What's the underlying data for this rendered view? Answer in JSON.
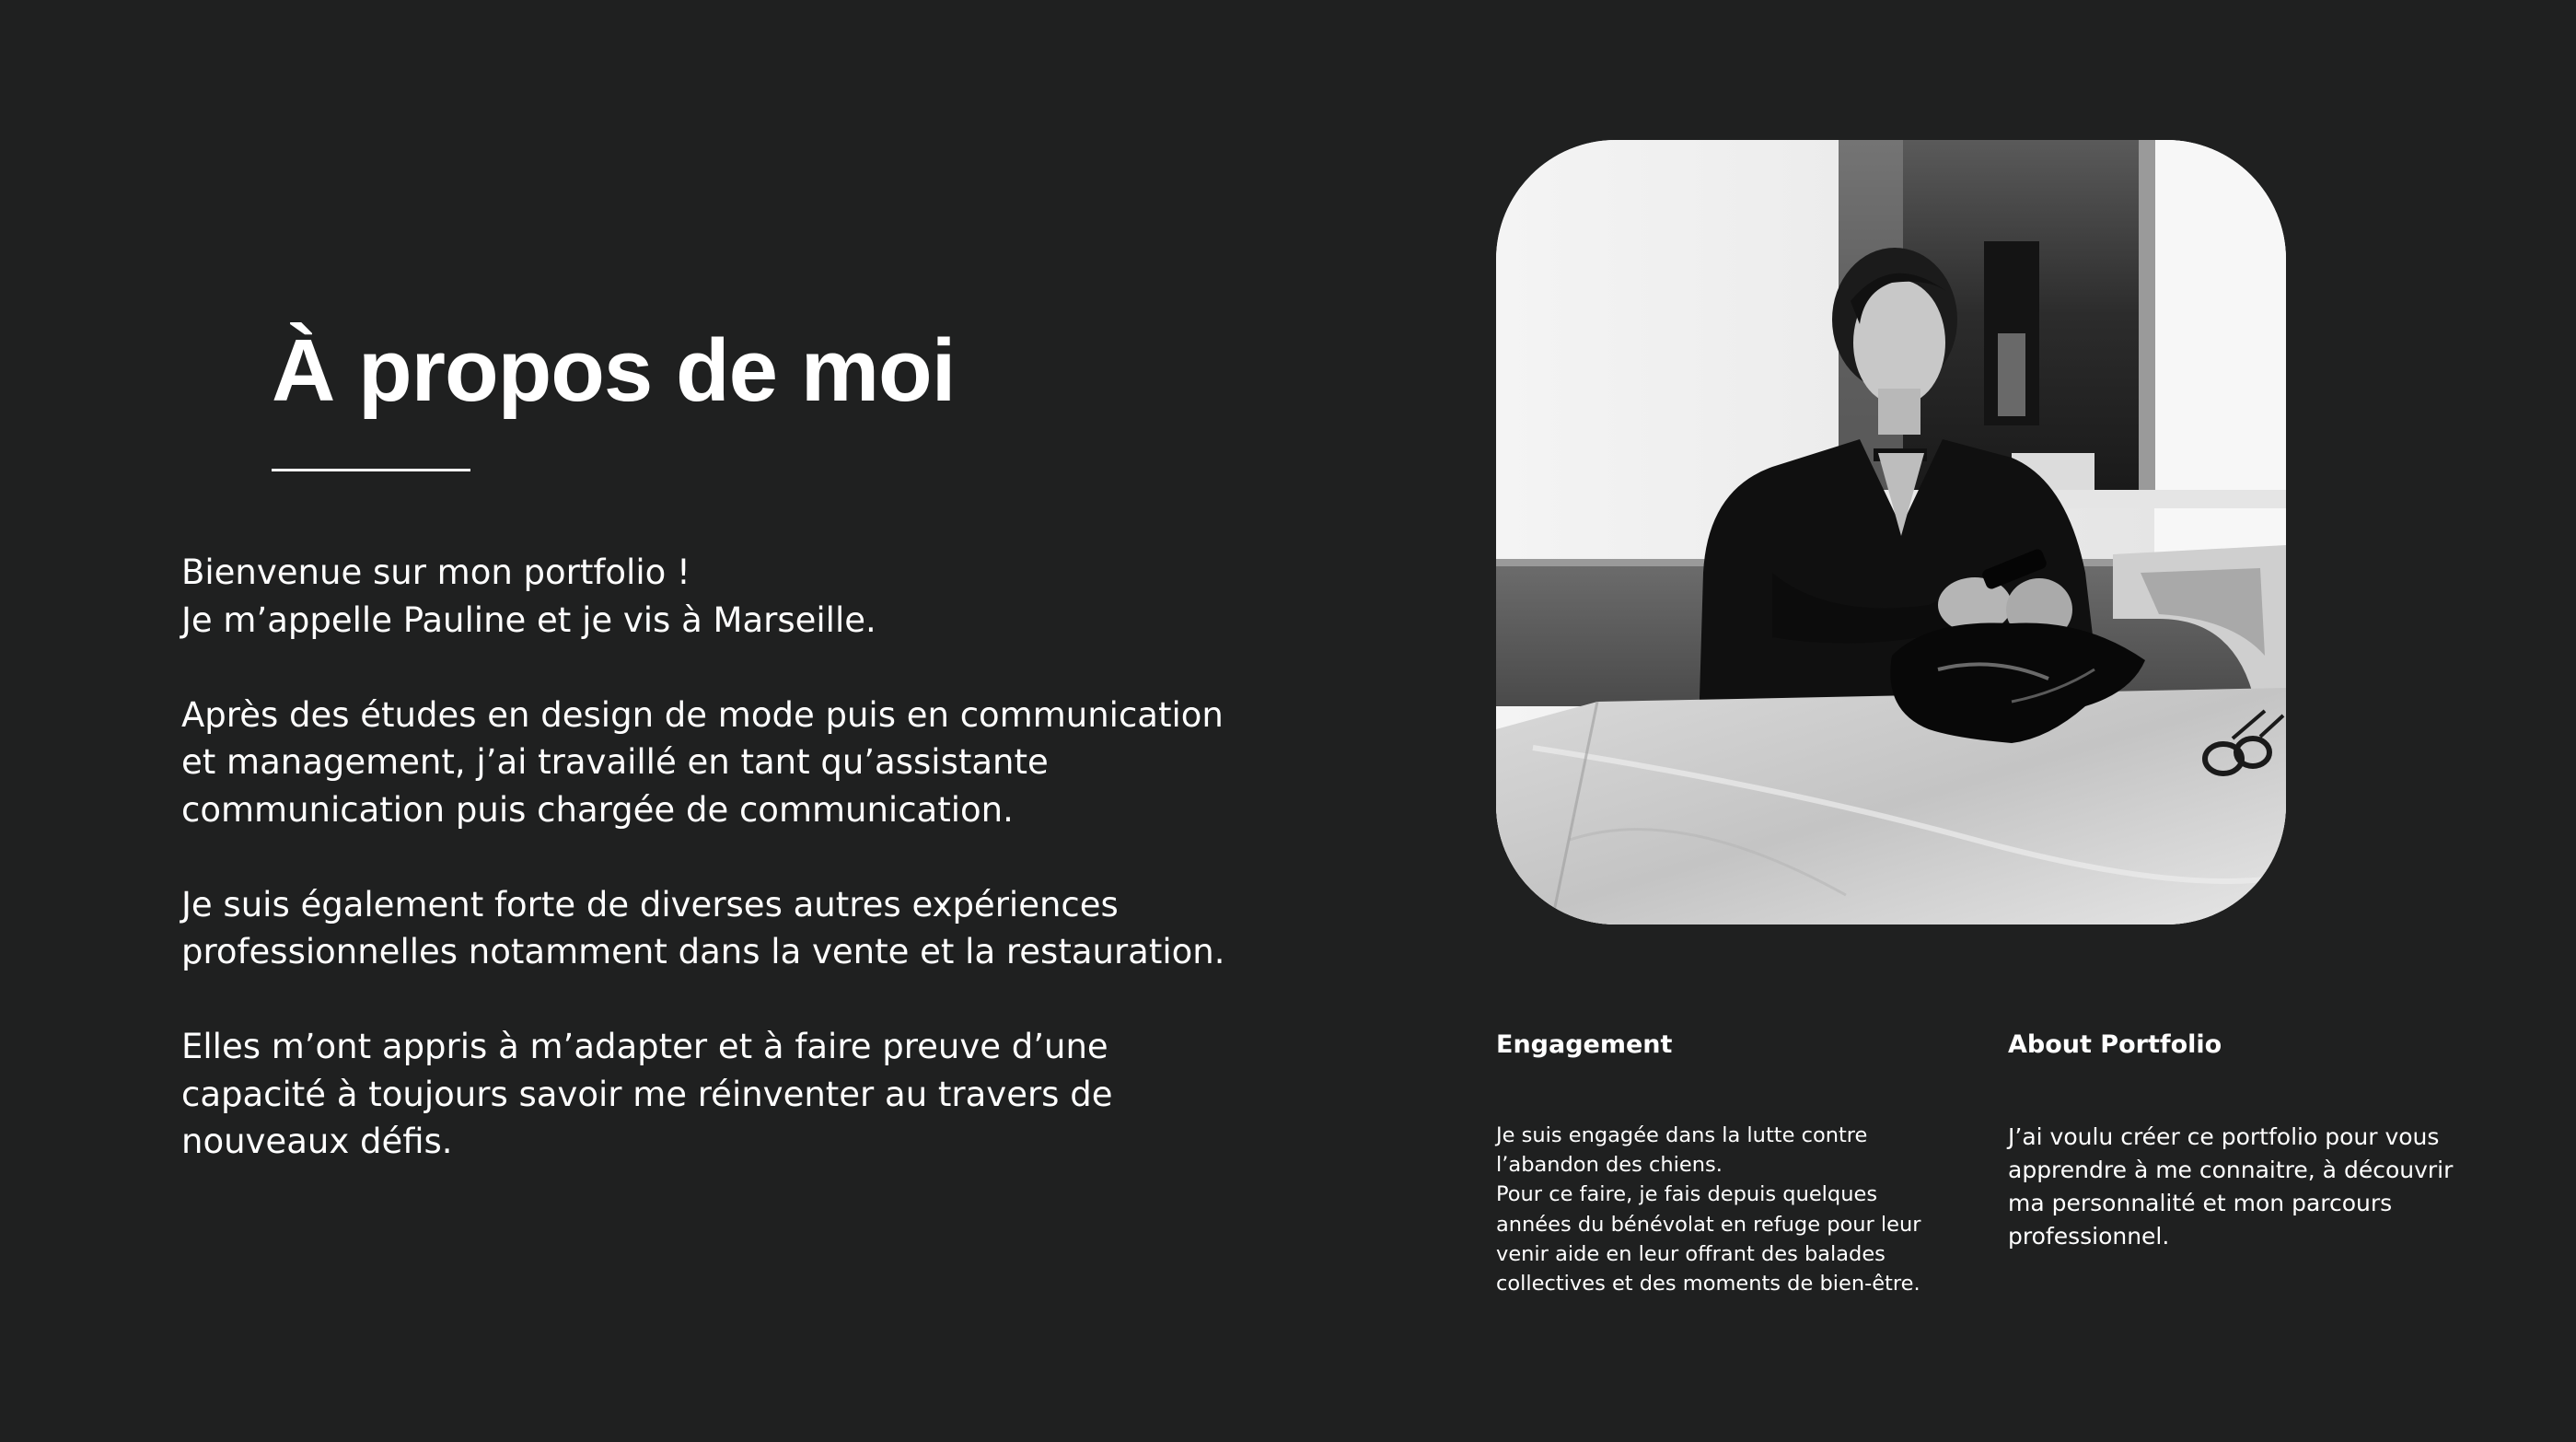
{
  "about": {
    "title": "À propos de moi",
    "intro_paragraphs": [
      "Bienvenue sur mon portfolio !\nJe m’appelle Pauline et je vis à Marseille.",
      "Après des études en design de mode puis en communication et management, j’ai travaillé en tant qu’assistante communication puis chargée de communication.",
      "Je suis également forte de  diverses autres expériences professionnelles notamment dans la vente et la restauration.",
      "Elles m’ont appris à m’adapter et à faire preuve d’une capacité à toujours savoir me réinventer au travers de nouveaux défis."
    ]
  },
  "photo": {
    "alt": "portrait-photo"
  },
  "engagement": {
    "title": "Engagement",
    "body": "Je suis engagée dans la lutte contre\nl’abandon des chiens.\nPour ce faire,  je fais depuis quelques\nannées du bénévolat en refuge pour leur\nvenir aide en leur offrant des balades\ncollectives et des moments de bien-être."
  },
  "about_portfolio": {
    "title": "About Portfolio",
    "body": "J’ai voulu créer ce portfolio pour vous\napprendre à me connaitre, à découvrir\nma personnalité et mon parcours\nprofessionnel."
  },
  "colors": {
    "background": "#1f2020",
    "text": "#ffffff"
  }
}
